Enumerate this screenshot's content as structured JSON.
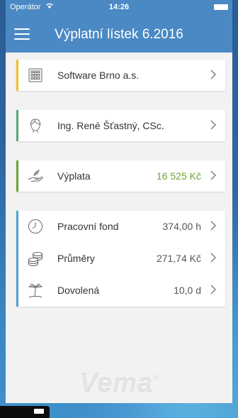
{
  "status_bar": {
    "carrier": "Operátor",
    "wifi_icon": "wifi-icon",
    "time": "14:26",
    "battery_icon": "battery-icon"
  },
  "header": {
    "menu_icon": "hamburger-menu-icon",
    "title": "Výplatní lístek 6.2016",
    "background_color": "#4a89c4"
  },
  "cards": {
    "company": {
      "label": "Software Brno a.s.",
      "icon": "building-icon",
      "accent_color": "#f2c224"
    },
    "employee": {
      "label": "Ing. René Šťastný, CSc.",
      "icon": "person-icon",
      "accent_color": "#5aa577"
    },
    "salary": {
      "label": "Výplata",
      "value": "16 525 Kč",
      "value_color": "#6aa632",
      "icon": "hand-money-icon",
      "accent_color": "#6aa632"
    },
    "details": {
      "accent_color": "#4aa3d6",
      "rows": [
        {
          "label": "Pracovní fond",
          "value": "374,00 h",
          "icon": "clock-icon"
        },
        {
          "label": "Průměry",
          "value": "271,74 Kč",
          "icon": "coins-icon"
        },
        {
          "label": "Dovolená",
          "value": "10,0 d",
          "icon": "palm-tree-icon"
        }
      ]
    }
  },
  "logo": {
    "text": "Vema",
    "mark": "®"
  }
}
